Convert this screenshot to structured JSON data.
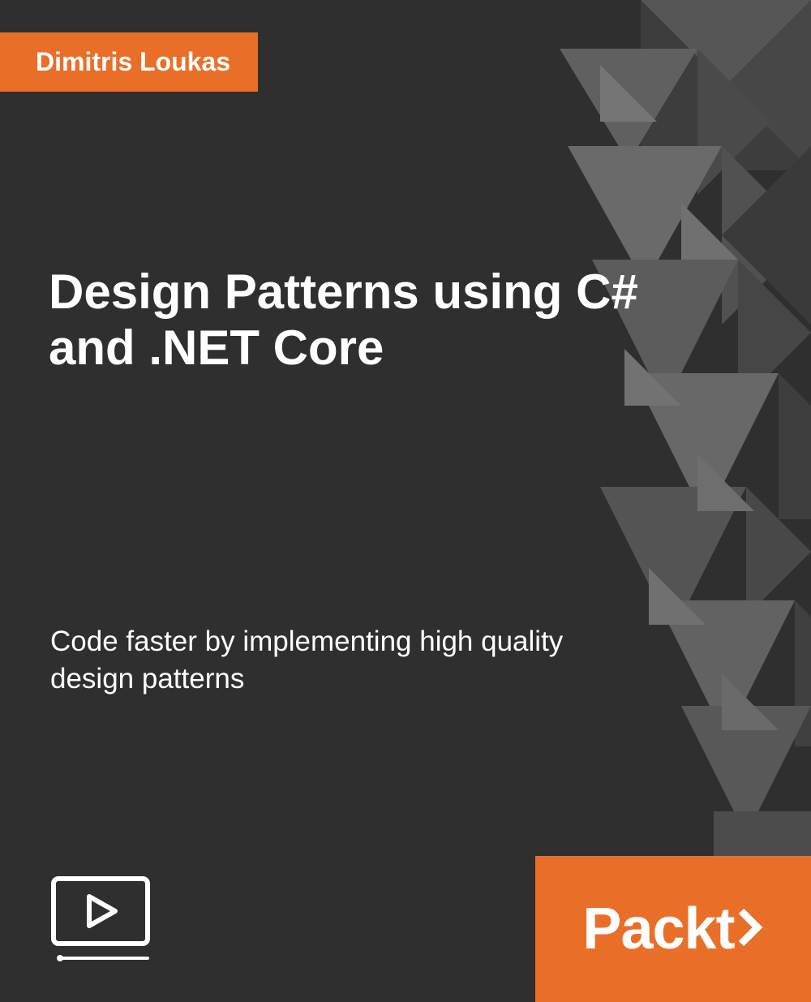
{
  "author": "Dimitris Loukas",
  "title": "Design Patterns using C# and .NET Core",
  "subtitle": "Code faster by implementing high quality design patterns",
  "publisher": "Packt",
  "colors": {
    "background": "#2f2f2f",
    "accent": "#e96f28",
    "text": "#ffffff"
  }
}
